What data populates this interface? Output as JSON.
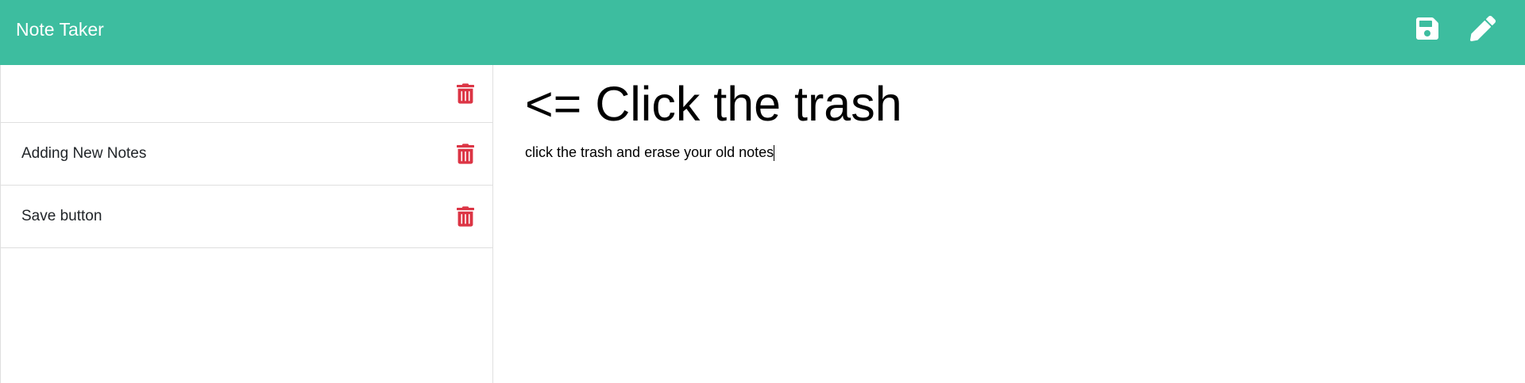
{
  "app": {
    "title": "Note Taker"
  },
  "header": {
    "icons": [
      {
        "name": "save-icon"
      },
      {
        "name": "pencil-icon"
      }
    ]
  },
  "sidebar": {
    "notes": [
      {
        "title": ""
      },
      {
        "title": "Adding New Notes"
      },
      {
        "title": "Save button"
      }
    ]
  },
  "editor": {
    "title": "<= Click the trash",
    "body": "click the trash and erase your old notes"
  },
  "colors": {
    "navbar": "#3dbd9f",
    "trash": "#dc3545",
    "icon": "#ffffff"
  }
}
